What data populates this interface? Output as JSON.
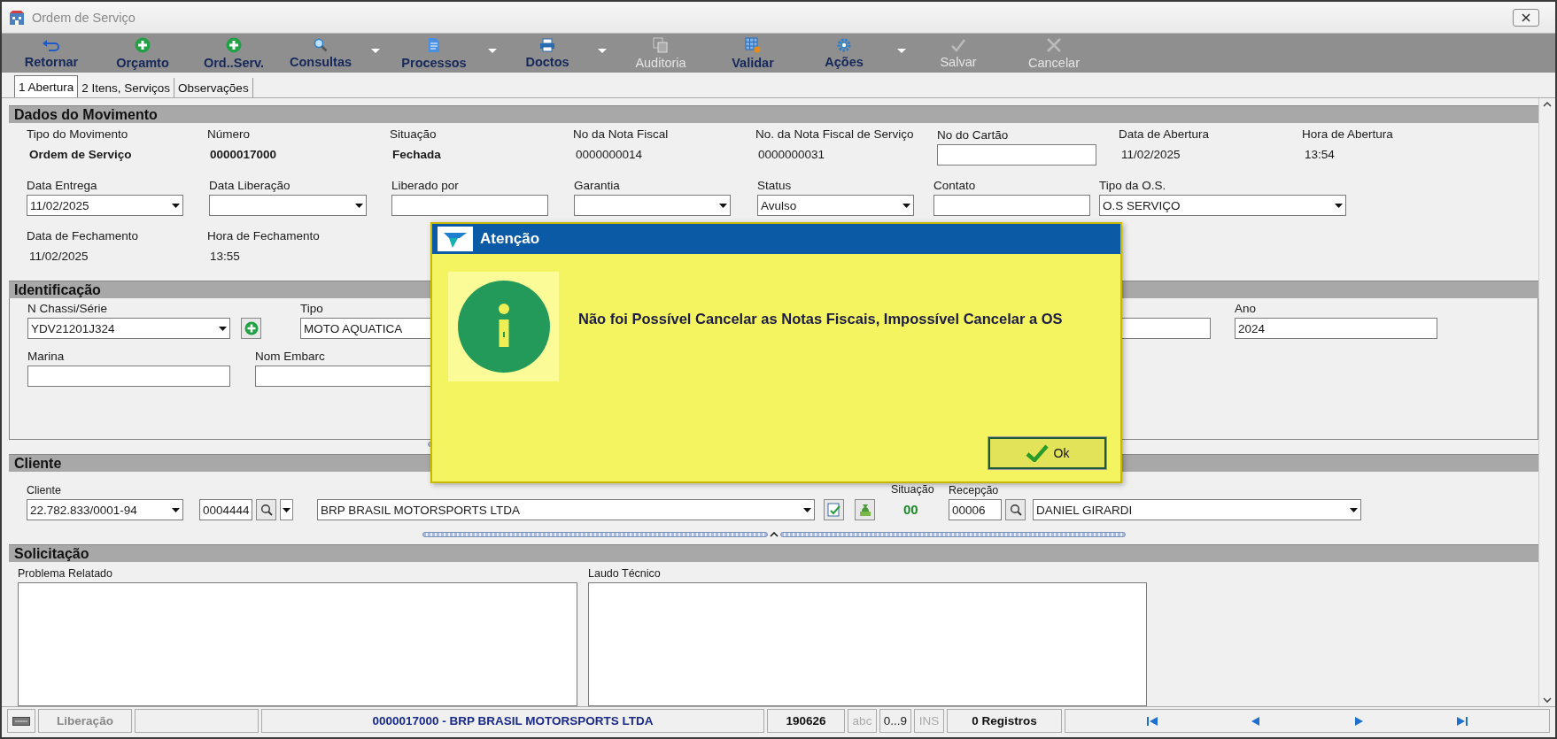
{
  "window": {
    "title": "Ordem de Serviço"
  },
  "toolbar": [
    {
      "label": "Retornar",
      "disabled": false,
      "has_menu": false
    },
    {
      "label": "Orçamto",
      "disabled": false,
      "has_menu": false
    },
    {
      "label": "Ord..Serv.",
      "disabled": false,
      "has_menu": false
    },
    {
      "label": "Consultas",
      "disabled": false,
      "has_menu": true
    },
    {
      "label": "Processos",
      "disabled": false,
      "has_menu": true
    },
    {
      "label": "Doctos",
      "disabled": false,
      "has_menu": true
    },
    {
      "label": "Auditoria",
      "disabled": true,
      "has_menu": false
    },
    {
      "label": "Validar",
      "disabled": false,
      "has_menu": false
    },
    {
      "label": "Ações",
      "disabled": false,
      "has_menu": true
    },
    {
      "label": "Salvar",
      "disabled": true,
      "has_menu": false
    },
    {
      "label": "Cancelar",
      "disabled": true,
      "has_menu": false
    }
  ],
  "tabs": [
    {
      "label": "1 Abertura",
      "selected": true
    },
    {
      "label": "2 Itens, Serviços",
      "selected": false
    },
    {
      "label": "Observações",
      "selected": false
    }
  ],
  "sections": [
    {
      "title": "Dados do Movimento",
      "rows": [
        [
          {
            "kind": "value",
            "label": "Tipo do Movimento",
            "value": "Ordem de Serviço",
            "bold": true
          },
          {
            "kind": "value",
            "label": "Número",
            "value": "0000017000",
            "bold": true
          },
          {
            "kind": "value",
            "label": "Situação",
            "value": "Fechada",
            "bold": true
          },
          {
            "kind": "value",
            "label": "No da Nota Fiscal",
            "value": "0000000014",
            "bold": false
          },
          {
            "kind": "value",
            "label": "No. da Nota Fiscal de Serviço",
            "value": "0000000031",
            "bold": false
          },
          {
            "kind": "input",
            "label": "No do Cartão"
          },
          {
            "kind": "value",
            "label": "Data de Abertura",
            "value": "11/02/2025",
            "bold": false
          },
          {
            "kind": "value",
            "label": "Hora de Abertura",
            "value": "13:54",
            "bold": false
          }
        ],
        [
          {
            "kind": "select",
            "label": "Data Entrega",
            "value": "11/02/2025"
          },
          {
            "kind": "select",
            "label": "Data Liberação"
          },
          {
            "kind": "input",
            "label": "Liberado por"
          },
          {
            "kind": "select",
            "label": "Garantia"
          },
          {
            "kind": "select",
            "label": "Status",
            "value": "Avulso"
          },
          {
            "kind": "input",
            "label": "Contato"
          },
          {
            "kind": "select",
            "label": "Tipo da O.S.",
            "value": "O.S SERVIÇO"
          }
        ],
        [
          {
            "kind": "value",
            "label": "Data de Fechamento",
            "value": "11/02/2025",
            "bold": false
          },
          {
            "kind": "value",
            "label": "Hora de Fechamento",
            "value": "13:55",
            "bold": false
          }
        ]
      ]
    },
    {
      "title": "Identificação",
      "rows": [
        [
          {
            "kind": "select",
            "label": "N Chassi/Série",
            "value": "YDV21201J324"
          },
          {
            "kind": "add_button"
          },
          {
            "kind": "input",
            "label": "Tipo",
            "value": "MOTO AQUATICA"
          },
          {
            "kind": "input"
          },
          {
            "kind": "input",
            "label": "Ano",
            "value": "2024"
          }
        ],
        [
          {
            "kind": "input",
            "label": "Marina"
          },
          {
            "kind": "input",
            "label": "Nom Embarc"
          }
        ]
      ]
    },
    {
      "title": "Cliente",
      "rows": [
        [
          {
            "kind": "select",
            "label": "Cliente",
            "value": "22.782.833/0001-94"
          },
          {
            "kind": "lookup",
            "value": "0004444",
            "has_dropdown": true
          },
          {
            "kind": "select",
            "value": "BRP BRASIL MOTORSPORTS LTDA"
          },
          {
            "kind": "confirm_button"
          },
          {
            "kind": "money_button"
          },
          {
            "kind": "status",
            "label": "Situação",
            "value": "00"
          },
          {
            "kind": "lookup",
            "label": "Recepção",
            "value": "00006",
            "has_dropdown": false
          },
          {
            "kind": "select",
            "value": "DANIEL GIRARDI"
          }
        ]
      ]
    },
    {
      "title": "Solicitação",
      "rows": [
        [
          {
            "kind": "textarea",
            "label": "Problema Relatado"
          },
          {
            "kind": "textarea",
            "label": "Laudo Técnico"
          }
        ]
      ]
    }
  ],
  "dialog": {
    "title": "Atenção",
    "message": "Não foi Possível Cancelar as Notas Fiscais, Impossível Cancelar a OS",
    "button": "Ok"
  },
  "status_bar": {
    "button": "Liberação",
    "record": "0000017000 - BRP BRASIL MOTORSPORTS LTDA",
    "code": "190626",
    "indicators": [
      {
        "text": "abc",
        "active": false
      },
      {
        "text": "0...9",
        "active": true
      },
      {
        "text": "INS",
        "active": false
      }
    ],
    "count": "0 Registros"
  }
}
